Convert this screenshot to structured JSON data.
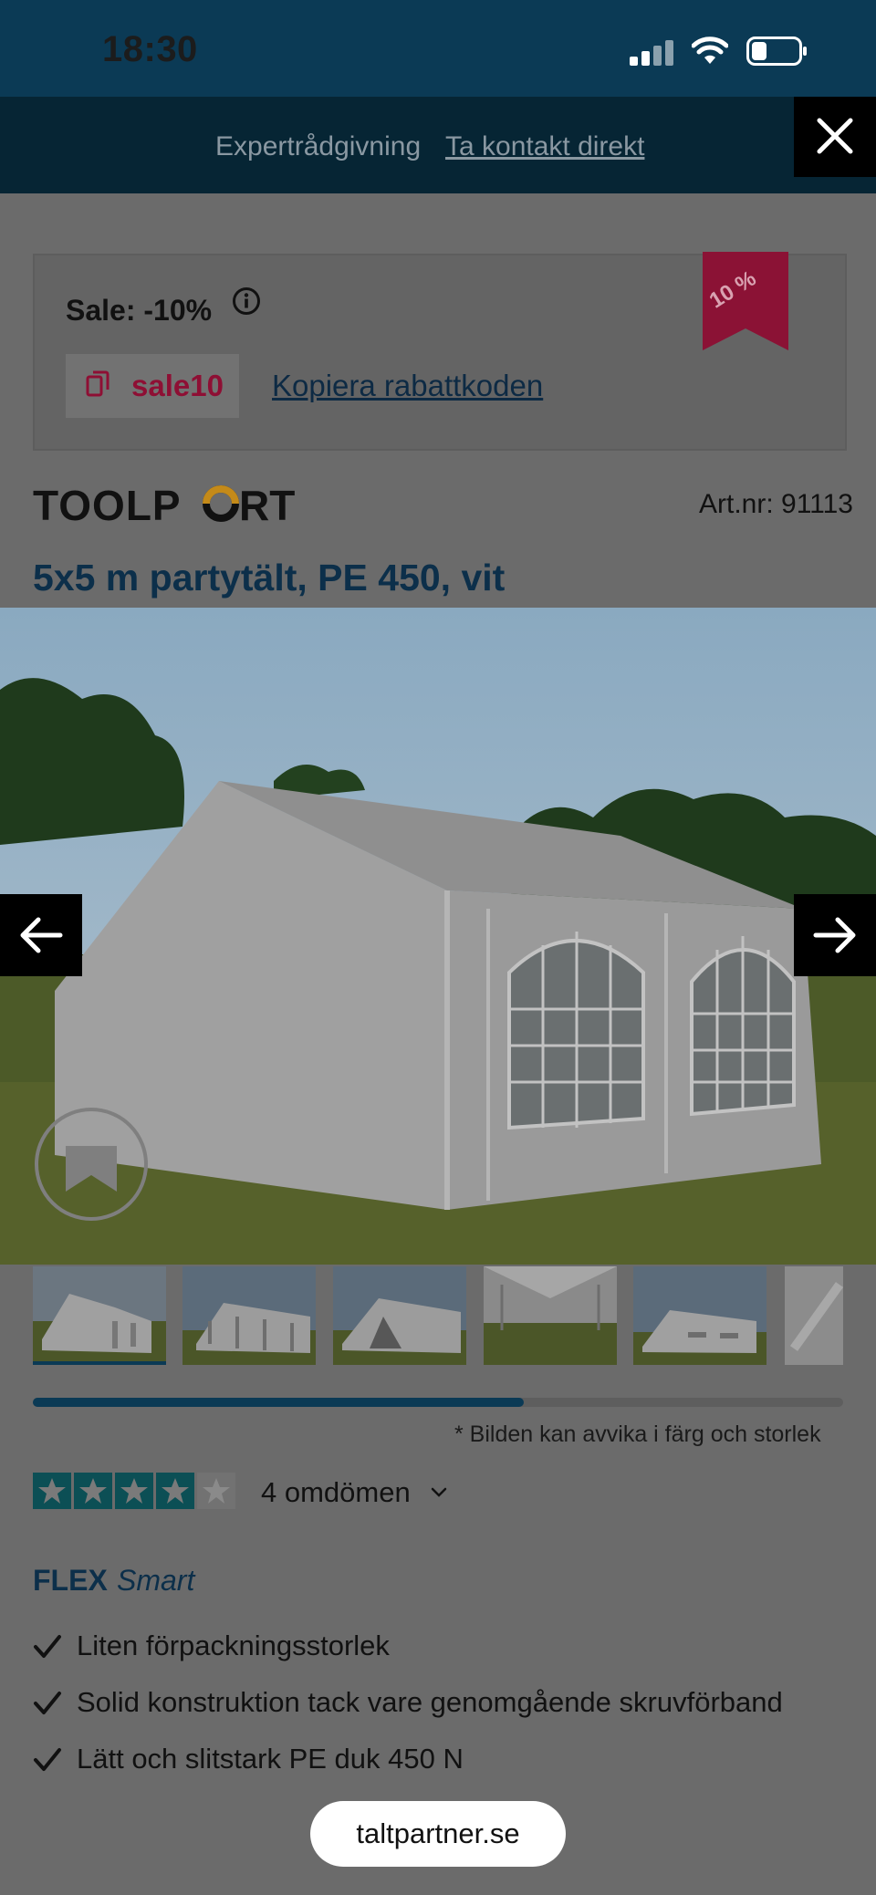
{
  "status_bar": {
    "time": "18:30"
  },
  "expert_bar": {
    "text": "Expertrådgivning",
    "link": "Ta kontakt direkt"
  },
  "sale": {
    "title": "Sale: -10%",
    "code": "sale10",
    "copy_link": "Kopiera rabattkoden",
    "ribbon": "10 %",
    "ribbon_color": "#c2104a"
  },
  "brand": {
    "logo_text": "TOOLPORT"
  },
  "product": {
    "art_nr": "Art.nr: 91113",
    "title": "5x5 m partytält, PE 450, vit",
    "disclaimer": "* Bilden kan avvika i färg och storlek",
    "gallery_progress_fraction": 0.61,
    "thumbnails_count_visible": 6
  },
  "rating": {
    "stars": 4,
    "max": 5,
    "label": "4 omdömen"
  },
  "features": {
    "brand_line": "FLEX",
    "brand_line_italic": "Smart",
    "items": [
      "Liten förpackningsstorlek",
      "Solid konstruktion tack vare genomgående skruvförband",
      "Lätt och slitstark PE duk 450 N"
    ]
  },
  "bottom_pill": {
    "domain": "taltpartner.se"
  },
  "colors": {
    "navy": "#0b3a55",
    "accent_red": "#8e0f34",
    "stars": "#0c6a6a"
  }
}
